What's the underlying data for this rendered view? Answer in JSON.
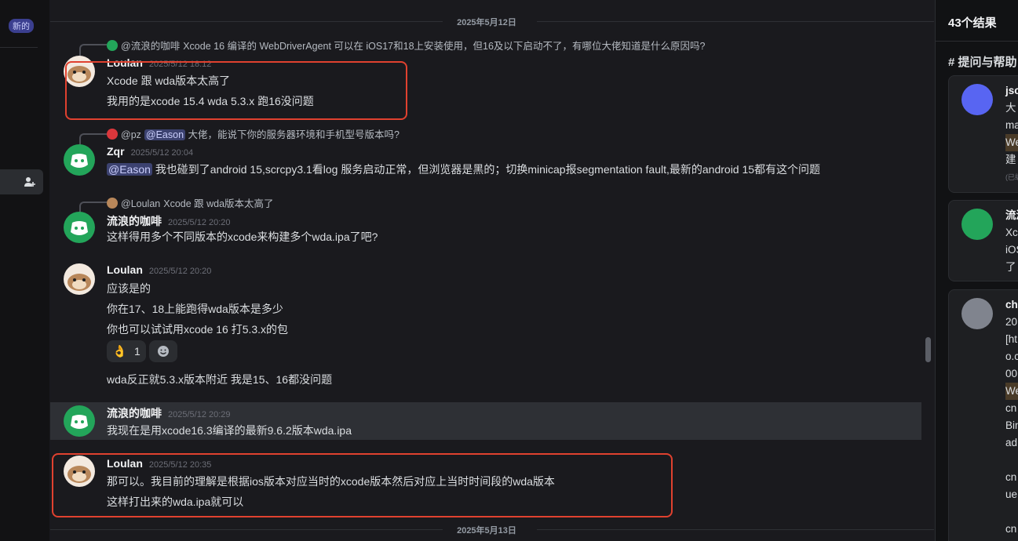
{
  "left": {
    "badge": "新的"
  },
  "dates": {
    "top": "2025年5月12日",
    "bottom": "2025年5月13日"
  },
  "messages": [
    {
      "reply_name": "@流浪的咖啡",
      "reply_text": "Xcode 16 编译的 WebDriverAgent 可以在 iOS17和18上安装使用，但16及以下启动不了，有哪位大佬知道是什么原因吗?",
      "author": "Loulan",
      "time": "2025/5/12 18:12",
      "lines": [
        "Xcode 跟 wda版本太高了",
        "我用的是xcode 15.4 wda 5.3.x 跑16没问题"
      ]
    },
    {
      "reply_name": "@pz",
      "reply_mention": "@Eason",
      "reply_text": "大佬，能说下你的服务器环境和手机型号版本吗?",
      "author": "Zqr",
      "time": "2025/5/12 20:04",
      "mention": "@Eason",
      "line": "我也碰到了android 15,scrcpy3.1看log 服务启动正常，但浏览器是黑的；切换minicap报segmentation fault,最新的android 15都有这个问题"
    },
    {
      "reply_name": "@Loulan",
      "reply_text": "Xcode 跟 wda版本太高了",
      "author": "流浪的咖啡",
      "time": "2025/5/12 20:20",
      "lines": [
        "这样得用多个不同版本的xcode来构建多个wda.ipa了吧?"
      ]
    },
    {
      "author": "Loulan",
      "time": "2025/5/12 20:20",
      "lines": [
        "应该是的",
        "你在17、18上能跑得wda版本是多少",
        "你也可以试试用xcode 16 打5.3.x的包"
      ],
      "reaction_emoji": "👌",
      "reaction_count": "1",
      "followup": "wda反正就5.3.x版本附近  我是15、16都没问题"
    },
    {
      "author": "流浪的咖啡",
      "time": "2025/5/12 20:29",
      "lines": [
        "我现在是用xcode16.3编译的最新9.6.2版本wda.ipa"
      ]
    },
    {
      "author": "Loulan",
      "time": "2025/5/12 20:35",
      "lines": [
        "那可以。我目前的理解是根据ios版本对应当时的xcode版本然后对应上当时时间段的wda版本",
        "这样打出来的wda.ipa就可以"
      ]
    }
  ],
  "right": {
    "count": "43个结果",
    "channel": "# 提问与帮助",
    "cards": [
      {
        "lines": [
          "jsc",
          "大",
          "ma",
          "We",
          "建",
          "(已编"
        ]
      },
      {
        "lines": [
          "流浪",
          "Xc",
          "iOS",
          "了"
        ]
      },
      {
        "lines": [
          "ch",
          "20",
          "[ht",
          "o.c",
          "00",
          "We",
          "cn",
          "Bin",
          "ad",
          "a",
          "cn",
          "ue",
          "a",
          "cn"
        ]
      }
    ]
  },
  "colors": {
    "accent": "#5865f2",
    "discord_green": "#23a55a",
    "highlight_box": "#e0412f"
  }
}
